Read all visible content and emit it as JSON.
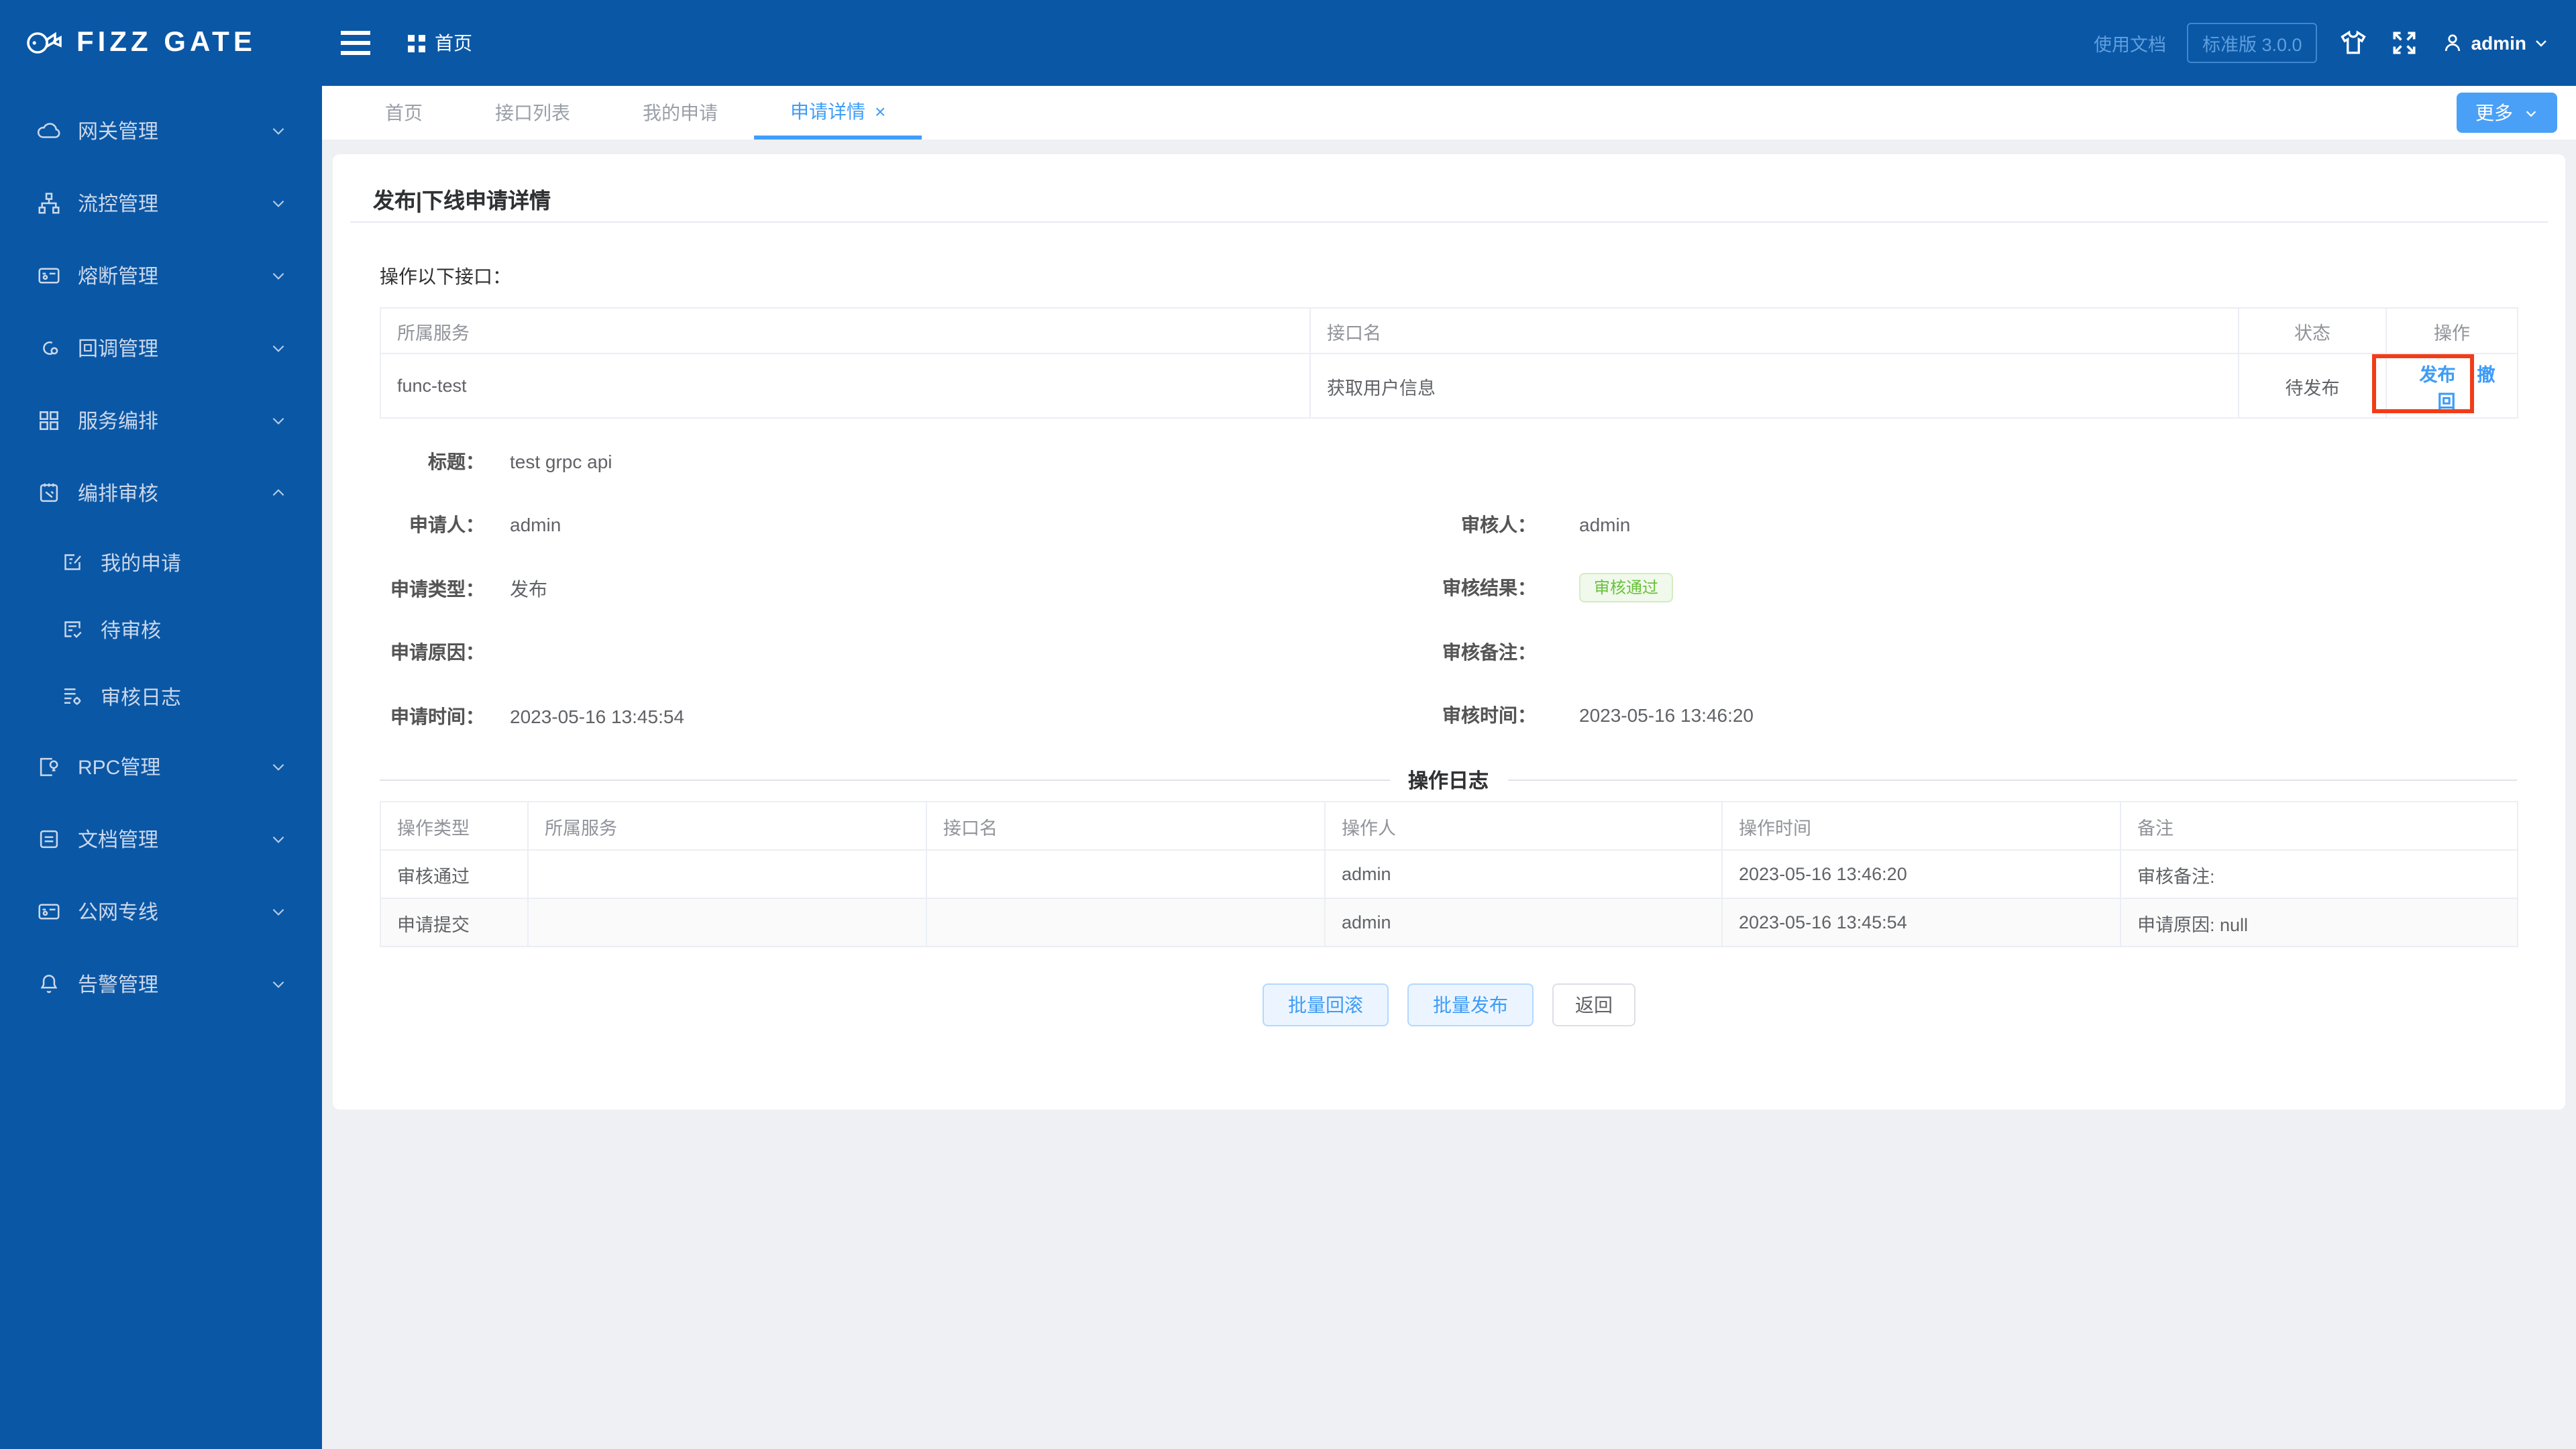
{
  "brand": {
    "logo_text": "FIZZ GATE"
  },
  "header": {
    "home_label": "首页",
    "docs_label": "使用文档",
    "version_label": "标准版 3.0.0",
    "username": "admin"
  },
  "tabbar": {
    "more_label": "更多",
    "close_glyph": "×"
  },
  "tabs": [
    {
      "label": "首页",
      "active": false
    },
    {
      "label": "接口列表",
      "active": false
    },
    {
      "label": "我的申请",
      "active": false
    },
    {
      "label": "申请详情",
      "active": true,
      "closable": true
    }
  ],
  "sidebar": {
    "items": [
      {
        "label": "网关管理",
        "icon": "cloud-icon"
      },
      {
        "label": "流控管理",
        "icon": "sitemap-icon"
      },
      {
        "label": "熔断管理",
        "icon": "circuit-card-icon"
      },
      {
        "label": "回调管理",
        "icon": "callback-cloud-icon"
      },
      {
        "label": "服务编排",
        "icon": "grid-icon"
      },
      {
        "label": "编排审核",
        "icon": "audit-clipboard-icon",
        "expanded": true,
        "children": [
          {
            "label": "我的申请",
            "icon": "doc-edit-icon"
          },
          {
            "label": "待审核",
            "icon": "doc-check-icon"
          },
          {
            "label": "审核日志",
            "icon": "log-gear-icon"
          }
        ]
      },
      {
        "label": "RPC管理",
        "icon": "doc-bulb-icon"
      },
      {
        "label": "文档管理",
        "icon": "document-icon"
      },
      {
        "label": "公网专线",
        "icon": "leased-line-icon"
      },
      {
        "label": "告警管理",
        "icon": "bell-icon"
      }
    ]
  },
  "page": {
    "title": "发布|下线申请详情",
    "intro": "操作以下接口：",
    "interface_table": {
      "headers": [
        "所属服务",
        "接口名",
        "状态",
        "操作"
      ],
      "row": {
        "service": "func-test",
        "api": "获取用户信息",
        "status": "待发布",
        "action_publish": "发布",
        "action_withdraw": "撤回"
      }
    },
    "details": {
      "left": [
        {
          "label": "标题：",
          "value": "test grpc api"
        },
        {
          "label": "申请人：",
          "value": "admin"
        },
        {
          "label": "申请类型：",
          "value": "发布"
        },
        {
          "label": "申请原因：",
          "value": ""
        },
        {
          "label": "申请时间：",
          "value": "2023-05-16 13:45:54"
        }
      ],
      "right": [
        {
          "label": "审核人：",
          "value": "admin"
        },
        {
          "label": "审核结果：",
          "badge": "审核通过"
        },
        {
          "label": "审核备注：",
          "value": ""
        },
        {
          "label": "审核时间：",
          "value": "2023-05-16 13:46:20"
        }
      ]
    },
    "log_section_title": "操作日志",
    "log_table": {
      "headers": [
        "操作类型",
        "所属服务",
        "接口名",
        "操作人",
        "操作时间",
        "备注"
      ],
      "rows": [
        [
          "审核通过",
          "",
          "",
          "admin",
          "2023-05-16 13:46:20",
          "审核备注:"
        ],
        [
          "申请提交",
          "",
          "",
          "admin",
          "2023-05-16 13:45:54",
          "申请原因: null"
        ]
      ]
    },
    "footer": {
      "batch_rollback": "批量回滚",
      "batch_publish": "批量发布",
      "back": "返回"
    }
  },
  "annotation": {
    "type": "highlight-box",
    "target": "发布",
    "color": "#f23c17"
  },
  "colors": {
    "primary_blue": "#409eff",
    "sidebar_blue": "#0a57a6",
    "success_green": "#67c23a",
    "annotation_red": "#f23c17",
    "page_bg": "#eef0f4"
  }
}
